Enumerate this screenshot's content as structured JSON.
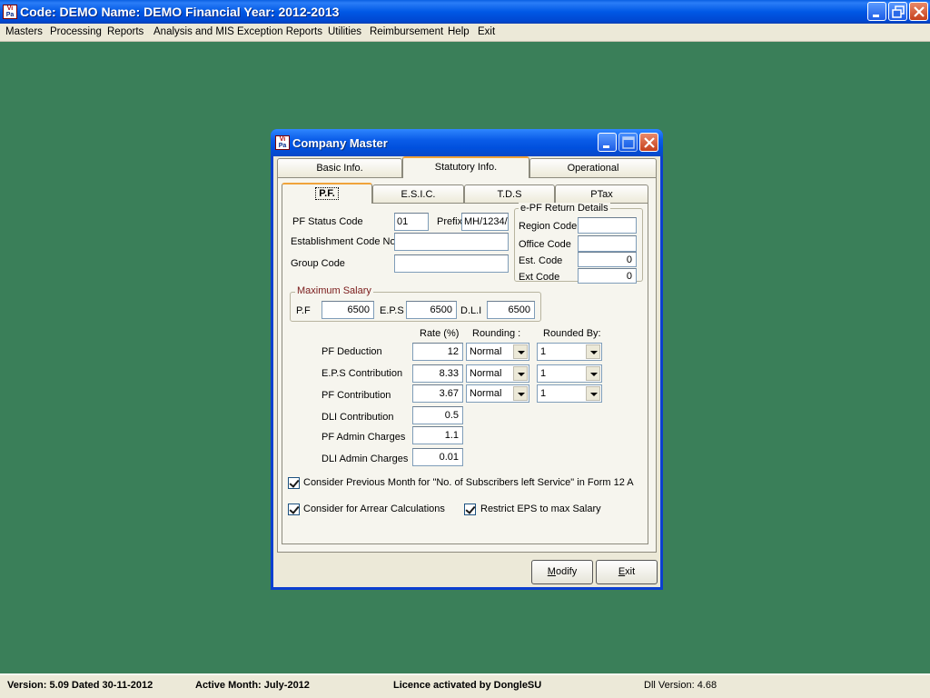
{
  "window": {
    "title": "Code: DEMO Name: DEMO Financial Year: 2012-2013",
    "logo_text_top": "Vi",
    "logo_text_bottom": "Pa"
  },
  "menu": [
    "Masters",
    "Processing",
    "Reports",
    "Analysis and MIS",
    "Exception Reports",
    "Utilities",
    "Reimbursement",
    "Help",
    "Exit"
  ],
  "status_bar": {
    "version": "Version: 5.09 Dated 30-11-2012",
    "active_month": "Active Month: July-2012",
    "licence": "Licence activated by DongleSU",
    "dll_version": "Dll Version: 4.68"
  },
  "dialog": {
    "title": "Company Master",
    "main_tabs": [
      "Basic Info.",
      "Statutory Info.",
      "Operational"
    ],
    "active_main_tab": "Statutory Info.",
    "sub_tabs": [
      "P.F.",
      "E.S.I.C.",
      "T.D.S",
      "PTax"
    ],
    "active_sub_tab": "P.F.",
    "pf": {
      "status_code_label": "PF Status Code",
      "status_code_value": "01",
      "prefix_label": "Prefix",
      "prefix_value": "MH/1234/",
      "establishment_label": "Establishment Code No",
      "establishment_value": "",
      "group_code_label": "Group Code",
      "group_code_value": ""
    },
    "epf_return": {
      "legend": "e-PF Return Details",
      "region_label": "Region Code",
      "region_value": "",
      "office_label": "Office Code",
      "office_value": "",
      "est_label": "Est. Code",
      "est_value": "0",
      "ext_label": "Ext Code",
      "ext_value": "0"
    },
    "max_salary": {
      "legend": "Maximum Salary",
      "pf_label": "P.F",
      "pf_value": "6500",
      "eps_label": "E.P.S",
      "eps_value": "6500",
      "dli_label": "D.L.I",
      "dli_value": "6500"
    },
    "rates": {
      "headers": {
        "rate": "Rate (%)",
        "rounding": "Rounding :",
        "rounded_by": "Rounded By:"
      },
      "rows": [
        {
          "label": "PF Deduction",
          "rate": "12",
          "rounding": "Normal",
          "rounded_by": "1"
        },
        {
          "label": "E.P.S Contribution",
          "rate": "8.33",
          "rounding": "Normal",
          "rounded_by": "1"
        },
        {
          "label": "PF Contribution",
          "rate": "3.67",
          "rounding": "Normal",
          "rounded_by": "1"
        },
        {
          "label": "DLI Contribution",
          "rate": "0.5"
        },
        {
          "label": "PF Admin Charges",
          "rate": "1.1"
        },
        {
          "label": "DLI Admin Charges",
          "rate": "0.01"
        }
      ]
    },
    "checkboxes": {
      "prev_month": {
        "label": "Consider Previous Month for \"No. of Subscribers left Service\" in Form 12 A",
        "checked": true
      },
      "arrear": {
        "label": "Consider for Arrear Calculations",
        "checked": true
      },
      "restrict_eps": {
        "label": "Restrict EPS to max Salary",
        "checked": true
      }
    },
    "buttons": {
      "modify_label_u": "M",
      "modify_label_rest": "odify",
      "exit_label_u": "E",
      "exit_label_rest": "xit"
    }
  }
}
